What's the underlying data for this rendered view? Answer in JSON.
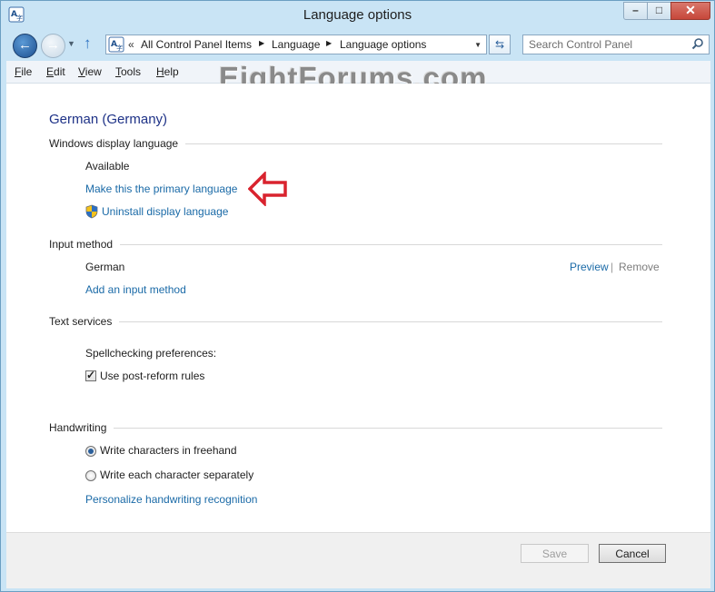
{
  "window": {
    "title": "Language options"
  },
  "address": {
    "chevron": "«",
    "crumbs": [
      "All Control Panel Items",
      "Language",
      "Language options"
    ]
  },
  "search": {
    "placeholder": "Search Control Panel"
  },
  "menu": {
    "file": {
      "first": "F",
      "rest": "ile"
    },
    "edit": {
      "first": "E",
      "rest": "dit"
    },
    "view": {
      "first": "V",
      "rest": "iew"
    },
    "tools": {
      "first": "T",
      "rest": "ools"
    },
    "help": {
      "first": "H",
      "rest": "elp"
    }
  },
  "watermark": "EightForums.com",
  "page": {
    "title": "German (Germany)",
    "display_language": {
      "heading": "Windows display language",
      "status": "Available",
      "make_primary_link": "Make this the primary language",
      "uninstall_link": "Uninstall display language"
    },
    "input_method": {
      "heading": "Input method",
      "method_name": "German",
      "preview_link": "Preview",
      "separator": "|",
      "remove_link": "Remove",
      "add_link": "Add an input method"
    },
    "text_services": {
      "heading": "Text services",
      "spellcheck_label": "Spellchecking preferences:",
      "post_reform_label": "Use post-reform rules",
      "post_reform_checked": true
    },
    "handwriting": {
      "heading": "Handwriting",
      "freehand_label": "Write characters in freehand",
      "separately_label": "Write each character separately",
      "selected": "freehand",
      "personalize_link": "Personalize handwriting recognition"
    }
  },
  "buttons": {
    "save": "Save",
    "cancel": "Cancel"
  },
  "colors": {
    "link": "#1a6aa7",
    "title": "#1e3287",
    "arrow": "#d9232e"
  }
}
